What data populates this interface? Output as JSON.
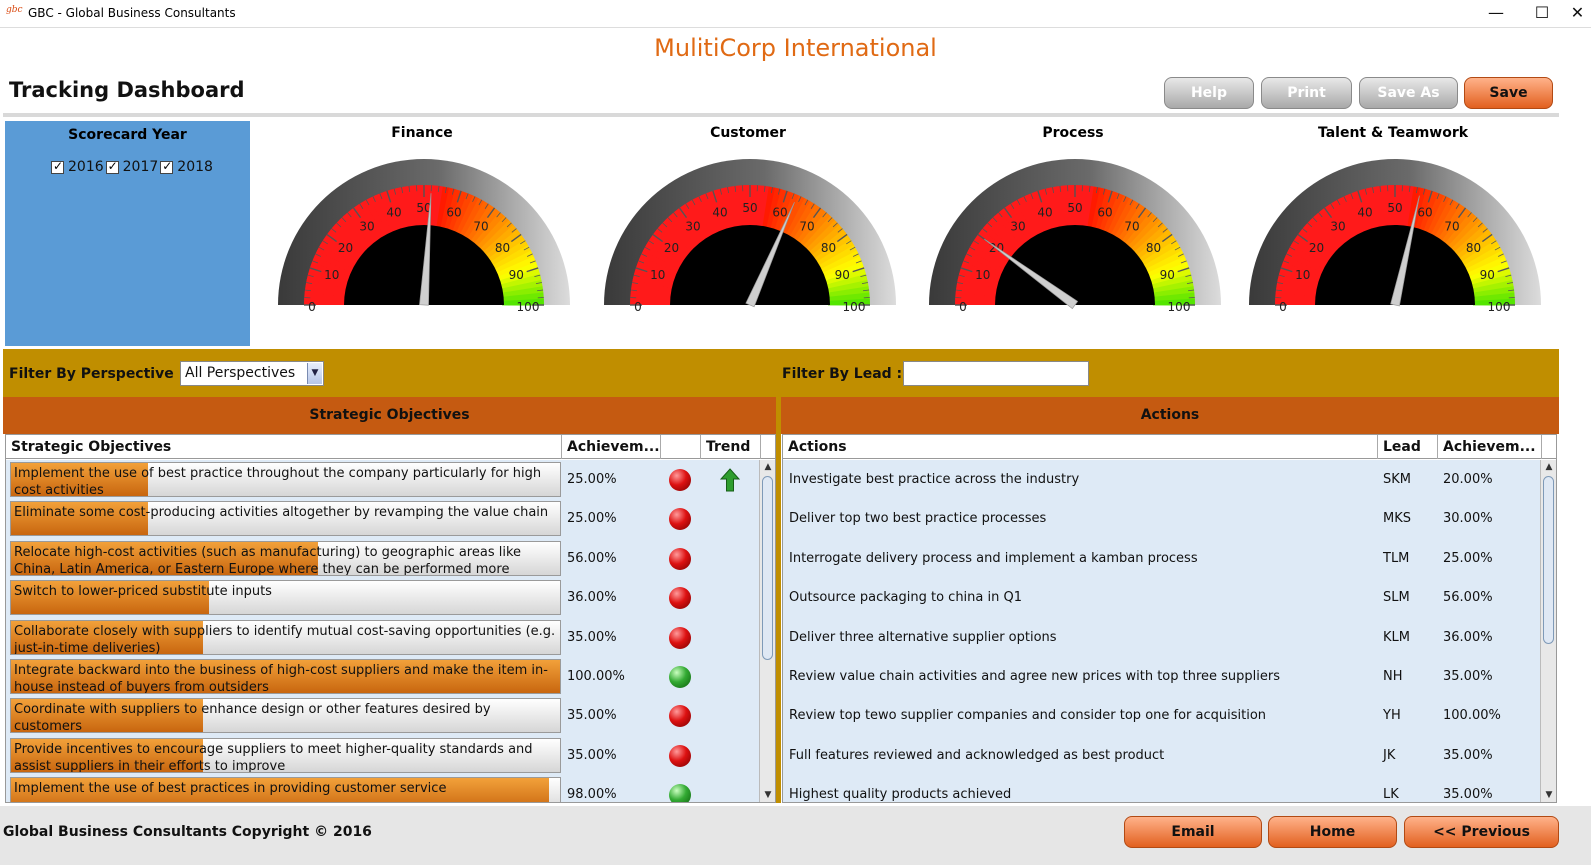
{
  "window": {
    "title": "GBC - Global Business Consultants",
    "icon_text": "gbc"
  },
  "header": {
    "app_title": "MulitiCorp International",
    "dashboard_title": "Tracking Dashboard",
    "buttons": {
      "help": "Help",
      "print": "Print",
      "save_as": "Save As",
      "save": "Save"
    }
  },
  "scorecard": {
    "title": "Scorecard Year",
    "years": [
      "2016",
      "2017",
      "2018"
    ]
  },
  "gauges": [
    {
      "title": "Finance",
      "value": 52
    },
    {
      "title": "Customer",
      "value": 63
    },
    {
      "title": "Process",
      "value": 20
    },
    {
      "title": "Talent & Teamwork",
      "value": 57
    }
  ],
  "gauge_ticks": [
    "0",
    "10",
    "20",
    "30",
    "40",
    "50",
    "60",
    "70",
    "80",
    "90",
    "100"
  ],
  "filters": {
    "perspective_label": "Filter By Perspective :",
    "perspective_value": "All Perspectives",
    "lead_label": "Filter By Lead :",
    "lead_value": ""
  },
  "objectives": {
    "section_title": "Strategic Objectives",
    "columns": [
      "Strategic Objectives",
      "Achievem...",
      "",
      "Trend"
    ],
    "rows": [
      {
        "text": "Implement the use of best practice throughout the company particularly for high cost activities",
        "achievement": "25.00%",
        "pct": 25,
        "status": "red",
        "trend": "up"
      },
      {
        "text": "Eliminate some cost-producing activities altogether by revamping the value chain",
        "achievement": "25.00%",
        "pct": 25,
        "status": "red",
        "trend": ""
      },
      {
        "text": "Relocate high-cost activities (such as manufacturing) to geographic areas like China, Latin America, or Eastern Europe where they can be performed more cheaply",
        "achievement": "56.00%",
        "pct": 56,
        "status": "red",
        "trend": ""
      },
      {
        "text": "Switch to lower-priced substitute inputs",
        "achievement": "36.00%",
        "pct": 36,
        "status": "red",
        "trend": ""
      },
      {
        "text": "Collaborate closely with suppliers to identify mutual cost-saving opportunities (e.g. just-in-time deliveries)",
        "achievement": "35.00%",
        "pct": 35,
        "status": "red",
        "trend": ""
      },
      {
        "text": "Integrate backward into the business of high-cost suppliers and make the item in-house instead of buyers from outsiders",
        "achievement": "100.00%",
        "pct": 100,
        "status": "green",
        "trend": ""
      },
      {
        "text": "Coordinate with suppliers to enhance design or other features desired by customers",
        "achievement": "35.00%",
        "pct": 35,
        "status": "red",
        "trend": ""
      },
      {
        "text": "Provide incentives to encourage suppliers to meet higher-quality standards and assist suppliers in their efforts to improve",
        "achievement": "35.00%",
        "pct": 35,
        "status": "red",
        "trend": ""
      },
      {
        "text": "Implement the use of best practices in providing customer service",
        "achievement": "98.00%",
        "pct": 98,
        "status": "green",
        "trend": ""
      }
    ]
  },
  "actions": {
    "section_title": "Actions",
    "columns": [
      "Actions",
      "Lead",
      "Achievem..."
    ],
    "rows": [
      {
        "action": "Investigate best practice across the industry",
        "lead": "SKM",
        "achievement": "20.00%"
      },
      {
        "action": "Deliver top two best practice processes",
        "lead": "MKS",
        "achievement": "30.00%"
      },
      {
        "action": "Interrogate delivery process and implement a kamban process",
        "lead": "TLM",
        "achievement": "25.00%"
      },
      {
        "action": "Outsource packaging to china in Q1",
        "lead": "SLM",
        "achievement": "56.00%"
      },
      {
        "action": "Deliver three alternative supplier options",
        "lead": "KLM",
        "achievement": "36.00%"
      },
      {
        "action": "Review value chain activities and agree new prices with top three suppliers",
        "lead": "NH",
        "achievement": "35.00%"
      },
      {
        "action": "Review top tewo supplier companies and consider top one for acquisition",
        "lead": "YH",
        "achievement": "100.00%"
      },
      {
        "action": "Full features reviewed and acknowledged as best product",
        "lead": "JK",
        "achievement": "35.00%"
      },
      {
        "action": "Highest quality products achieved",
        "lead": "LK",
        "achievement": "35.00%"
      }
    ]
  },
  "footer": {
    "copyright": "Global Business Consultants Copyright © 2016",
    "buttons": {
      "email": "Email",
      "home": "Home",
      "previous": "<< Previous"
    }
  },
  "colors": {
    "accent_orange": "#e06a14",
    "section_header": "#c55a11",
    "filter_bar": "#c08e00",
    "year_panel": "#5a9bd6",
    "table_bg": "#deeaf6"
  }
}
